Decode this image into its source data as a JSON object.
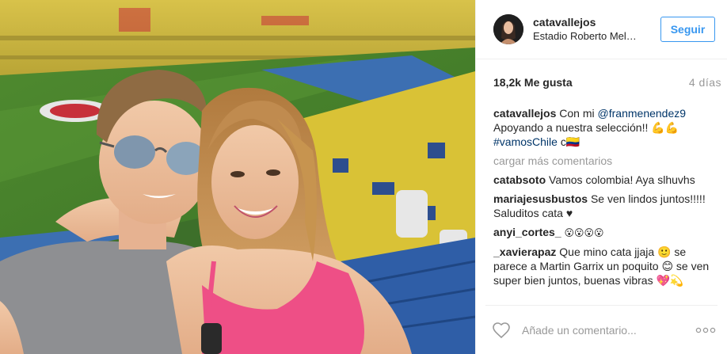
{
  "header": {
    "username": "catavallejos",
    "location": "Estadio Roberto Mel…",
    "follow_label": "Seguir"
  },
  "meta": {
    "likes": "18,2k Me gusta",
    "age": "4 días"
  },
  "caption": {
    "username": "catavallejos",
    "text_1": "Con mi",
    "mention": "@franmenendez9",
    "text_2": "Apoyando a nuestra selección!! 💪💪",
    "hashtag": "#vamosChile",
    "text_3": "c🇨🇴"
  },
  "load_more": "cargar más comentarios",
  "comments": [
    {
      "username": "catabsoto",
      "text": "Vamos colombia! Aya slhuvhs"
    },
    {
      "username": "mariajesusbustos",
      "text": "Se ven lindos juntos!!!!! Saluditos cata ♥"
    },
    {
      "username": "anyi_cortes_",
      "text": "😮😮😮😮"
    },
    {
      "username": "_xavierapaz",
      "text": "Que mino cata jjaja 🙂 se parece a Martin Garrix un poquito 😊 se ven super bien juntos, buenas vibras 💖💫"
    }
  ],
  "footer": {
    "add_comment_placeholder": "Añade un comentario...",
    "like_icon": "heart-outline-icon",
    "options_icon": "more-options-icon"
  },
  "colors": {
    "follow_blue": "#3897f0",
    "mention_blue": "#003569",
    "muted_gray": "#999999",
    "text": "#262626"
  }
}
